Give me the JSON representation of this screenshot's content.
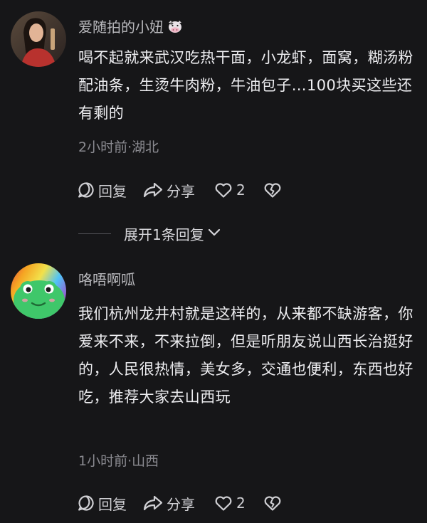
{
  "comments": [
    {
      "username": "爱随拍的小妞",
      "content": "喝不起就来武汉吃热干面，小龙虾，面窝，糊汤粉配油条，生烫牛肉粉，牛油包子…100块买这些还有剩的",
      "meta": "2小时前·湖北",
      "reply_label": "回复",
      "share_label": "分享",
      "like_count": "2",
      "badge_icon": "cow-icon"
    },
    {
      "username": "咯唔啊呱",
      "content": "我们杭州龙井村就是这样的，从来都不缺游客，你爱来不来，不来拉倒，但是听朋友说山西长治挺好的，人民很热情，美女多，交通也便利，东西也好吃，推荐大家去山西玩",
      "meta": "1小时前·山西",
      "reply_label": "回复",
      "share_label": "分享",
      "like_count": "2"
    }
  ],
  "expand_replies": {
    "label": "展开1条回复"
  },
  "colors": {
    "background": "#161618",
    "text": "#ededf0",
    "secondary": "#8a8a90"
  }
}
